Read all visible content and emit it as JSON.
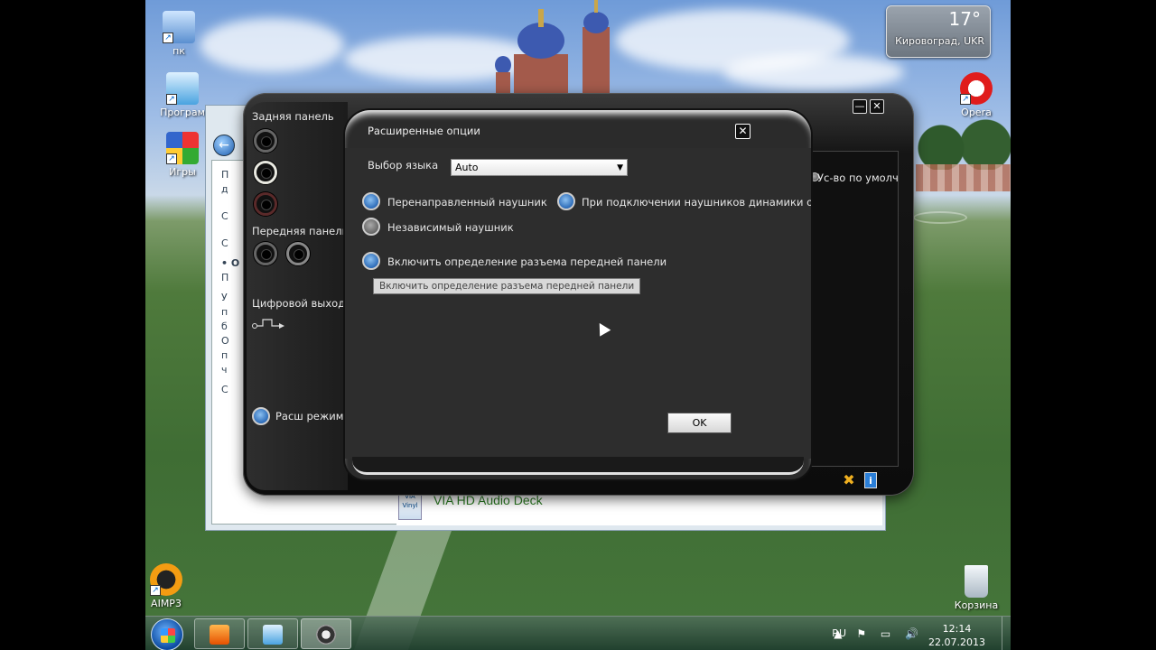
{
  "desktop": {
    "icons": [
      {
        "label": "пк",
        "icon": "computer-icon"
      },
      {
        "label": "Програм",
        "icon": "programs-icon"
      },
      {
        "label": "Игры",
        "icon": "games-icon"
      },
      {
        "label": "AIMP3",
        "icon": "aimp-icon"
      },
      {
        "label": "Opera",
        "icon": "opera-icon"
      },
      {
        "label": "Корзина",
        "icon": "recycle-bin-icon"
      }
    ]
  },
  "weather": {
    "temp": "17°",
    "city": "Кировоград, UKR"
  },
  "background_window": {
    "side_letters": [
      "П",
      "д",
      "С",
      "С",
      "О",
      "П",
      "У",
      "п",
      "б",
      "О",
      "п",
      "ч",
      "С"
    ],
    "via_item": "VIA HD Audio Deck",
    "via_logo": "VIA Vinyl"
  },
  "deck": {
    "rear_panel_label": "Задняя панель",
    "front_panel_label": "Передняя панель",
    "digital_out_label": "Цифровой выход",
    "advanced_mode_label": "Расш режим",
    "default_device_label": "Ус-во по умолч",
    "minimize": "—",
    "close": "✕",
    "tools_icon": "tools-icon",
    "info_icon": "info-icon"
  },
  "dialog": {
    "title": "Расширенные опции",
    "close": "✕",
    "language_label": "Выбор языка",
    "language_value": "Auto",
    "redirected_headphone": "Перенаправленный наушник",
    "mute_speakers": "При подключении наушников динамики отключ",
    "independent_headphone": "Независимый наушник",
    "front_jack_detection": "Включить определение разъема передней панели",
    "tooltip": "Включить определение разъема передней панели",
    "ok": "OK"
  },
  "taskbar": {
    "lang": "RU",
    "tray_icons": "▲ ⚑ ▭ 🔊",
    "time": "12:14",
    "date": "22.07.2013"
  }
}
